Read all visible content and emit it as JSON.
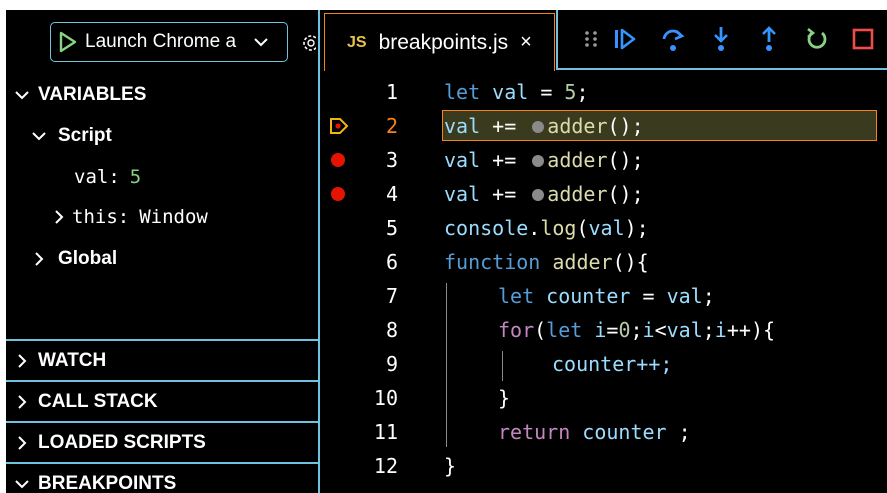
{
  "sidebar": {
    "launch_config": "Launch Chrome a",
    "sections": {
      "variables": "VARIABLES",
      "watch": "WATCH",
      "call_stack": "CALL STACK",
      "loaded_scripts": "LOADED SCRIPTS",
      "breakpoints": "BREAKPOINTS"
    },
    "tree": {
      "script": "Script",
      "val_name": "val:",
      "val_value": "5",
      "this_name": "this:",
      "this_value": "Window",
      "global": "Global"
    }
  },
  "tab": {
    "icon_label": "JS",
    "file_name": "breakpoints.js",
    "close": "×"
  },
  "toolbar": {
    "icons": [
      "drag-handle-icon",
      "continue-icon",
      "step-over-icon",
      "step-into-icon",
      "step-out-icon",
      "restart-icon",
      "stop-icon"
    ]
  },
  "editor": {
    "line_numbers": [
      "1",
      "2",
      "3",
      "4",
      "5",
      "6",
      "7",
      "8",
      "9",
      "10",
      "11",
      "12"
    ],
    "current_line": 2,
    "breakpoint_lines": [
      3,
      4
    ],
    "tokens": {
      "let": "let",
      "val": "val",
      "eq": " = ",
      "five": "5",
      "semi": ";",
      "plus_eq": " += ",
      "adder": "adder",
      "call_semi": "();",
      "console": "console",
      "dot": ".",
      "log": "log",
      "paren_open": "(",
      "paren_close_semi": ");",
      "function": "function",
      "adder_decl_rest": "(){",
      "counter": "counter",
      "for": "for",
      "i": "i",
      "eq0": "=",
      "zero": "0",
      "lt": "<",
      "inc": "++",
      "close_brace_open": "){",
      "counter_inc": "counter++;",
      "close_brace": "}",
      "return": "return",
      "space_semi": " ;"
    }
  },
  "colors": {
    "accent_border": "#6fc3df",
    "active_orange": "#f38518",
    "breakpoint_red": "#e51400",
    "toolbar_blue": "#3794ff",
    "restart_green": "#89d185",
    "stop_red": "#f14c4c"
  }
}
